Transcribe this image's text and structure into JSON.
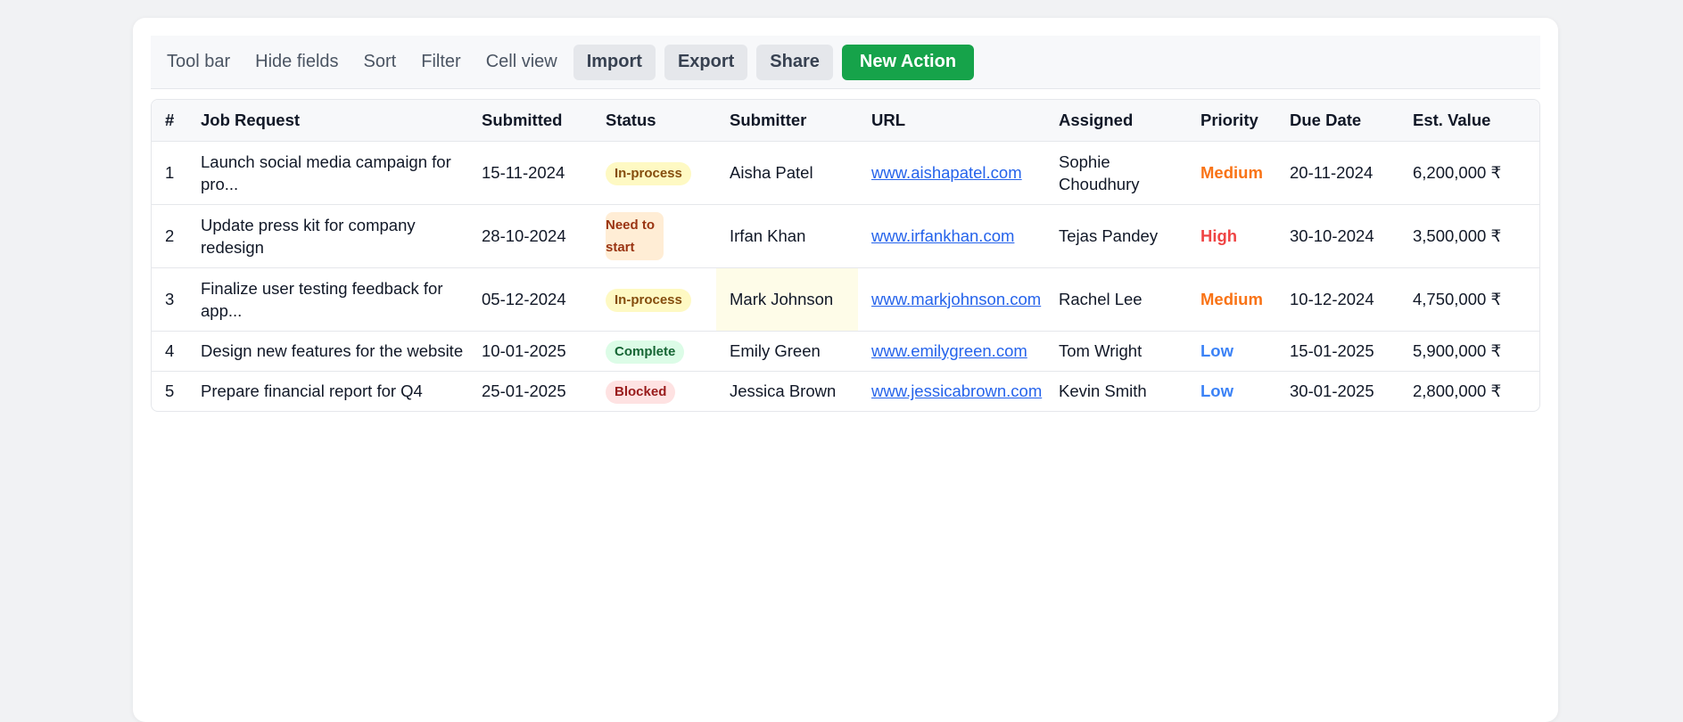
{
  "toolbar": {
    "links": [
      "Tool bar",
      "Hide fields",
      "Sort",
      "Filter",
      "Cell view"
    ],
    "buttons": [
      "Import",
      "Export",
      "Share"
    ],
    "primary": "New Action"
  },
  "table": {
    "headers": [
      "#",
      "Job Request",
      "Submitted",
      "Status",
      "Submitter",
      "URL",
      "Assigned",
      "Priority",
      "Due Date",
      "Est. Value"
    ],
    "rows": [
      {
        "num": "1",
        "job": "Launch social media campaign for pro...",
        "submitted": "15-11-2024",
        "status": "In-process",
        "submitter": "Aisha Patel",
        "url": "www.aishapatel.com",
        "assigned": "Sophie Choudhury",
        "priority": "Medium",
        "due": "20-11-2024",
        "value": "6,200,000 ₹"
      },
      {
        "num": "2",
        "job": "Update press kit for company redesign",
        "submitted": "28-10-2024",
        "status": "Need to start",
        "submitter": "Irfan Khan",
        "url": "www.irfankhan.com",
        "assigned": "Tejas Pandey",
        "priority": "High",
        "due": "30-10-2024",
        "value": "3,500,000 ₹"
      },
      {
        "num": "3",
        "job": "Finalize user testing feedback for app...",
        "submitted": "05-12-2024",
        "status": "In-process",
        "submitter": "Mark Johnson",
        "url": "www.markjohnson.com",
        "assigned": "Rachel Lee",
        "priority": "Medium",
        "due": "10-12-2024",
        "value": "4,750,000 ₹"
      },
      {
        "num": "4",
        "job": "Design new features for the website",
        "submitted": "10-01-2025",
        "status": "Complete",
        "submitter": "Emily Green",
        "url": "www.emilygreen.com",
        "assigned": "Tom Wright",
        "priority": "Low",
        "due": "15-01-2025",
        "value": "5,900,000 ₹"
      },
      {
        "num": "5",
        "job": "Prepare financial report for Q4",
        "submitted": "25-01-2025",
        "status": "Blocked",
        "submitter": "Jessica Brown",
        "url": "www.jessicabrown.com",
        "assigned": "Kevin Smith",
        "priority": "Low",
        "due": "30-01-2025",
        "value": "2,800,000 ₹"
      }
    ]
  },
  "colors": {
    "primary_button": "#16a34a",
    "status_in_process_bg": "#fef9c3",
    "status_in_process_fg": "#854d0e",
    "status_need_to_start_bg": "#ffedd5",
    "status_need_to_start_fg": "#9a3412",
    "status_complete_bg": "#dcfce7",
    "status_complete_fg": "#166534",
    "status_blocked_bg": "#fee2e2",
    "status_blocked_fg": "#991b1b",
    "priority_high": "#ef4444",
    "priority_medium": "#f97316",
    "priority_low": "#3b82f6",
    "link": "#2563eb"
  }
}
